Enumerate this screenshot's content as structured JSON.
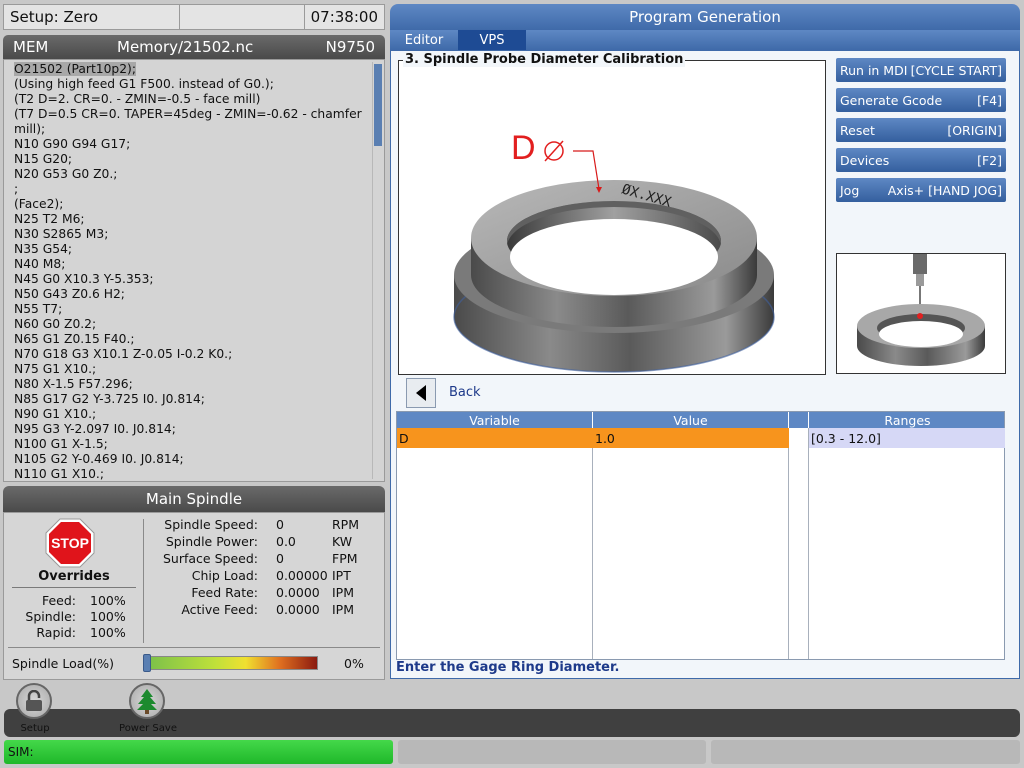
{
  "status": {
    "setup": "Setup: Zero",
    "clock": "07:38:00"
  },
  "program": {
    "mode": "MEM",
    "path": "Memory/21502.nc",
    "number": "N9750",
    "lines": [
      "O21502 (Part10p2);",
      "(Using high feed G1 F500. instead of G0.);",
      "(T2 D=2. CR=0. - ZMIN=-0.5 - face mill)",
      "(T7 D=0.5 CR=0. TAPER=45deg - ZMIN=-0.62 - chamfer",
      "mill);",
      "N10 G90 G94 G17;",
      "N15 G20;",
      "N20 G53 G0 Z0.;",
      ";",
      "(Face2);",
      "N25 T2 M6;",
      "N30 S2865 M3;",
      "N35 G54;",
      "N40 M8;",
      "N45 G0 X10.3 Y-5.353;",
      "N50 G43 Z0.6 H2;",
      "N55 T7;",
      "N60 G0 Z0.2;",
      "N65 G1 Z0.15 F40.;",
      "N70 G18 G3 X10.1 Z-0.05 I-0.2 K0.;",
      "N75 G1 X10.;",
      "N80 X-1.5 F57.296;",
      "N85 G17 G2 Y-3.725 I0. J0.814;",
      "N90 G1 X10.;",
      "N95 G3 Y-2.097 I0. J0.814;",
      "N100 G1 X-1.5;",
      "N105 G2 Y-0.469 I0. J0.814;",
      "N110 G1 X10.;"
    ]
  },
  "spindle": {
    "title": "Main Spindle",
    "stop_label": "STOP",
    "overrides_title": "Overrides",
    "overrides": [
      {
        "label": "Feed:",
        "value": "100%"
      },
      {
        "label": "Spindle:",
        "value": "100%"
      },
      {
        "label": "Rapid:",
        "value": "100%"
      }
    ],
    "stats": [
      {
        "label": "Spindle Speed:",
        "value": "0",
        "unit": "RPM"
      },
      {
        "label": "Spindle Power:",
        "value": "0.0",
        "unit": "KW"
      },
      {
        "label": "Surface Speed:",
        "value": "0",
        "unit": "FPM"
      },
      {
        "label": "Chip Load:",
        "value": "0.00000",
        "unit": "IPT"
      },
      {
        "label": "Feed Rate:",
        "value": "0.0000",
        "unit": "IPM"
      },
      {
        "label": "Active Feed:",
        "value": "0.0000",
        "unit": "IPM"
      }
    ],
    "load_label": "Spindle Load(%)",
    "load_value": "0%"
  },
  "program_generation": {
    "title": "Program Generation",
    "tabs": [
      "Editor",
      "VPS"
    ],
    "active_tab": "VPS",
    "section_title": "3. Spindle Probe Diameter Calibration",
    "diagram_label": "D",
    "ring_engraving": "ØX.XXX",
    "buttons": [
      {
        "label": "Run in MDI",
        "key": "[CYCLE START]"
      },
      {
        "label": "Generate Gcode",
        "key": "[F4]"
      },
      {
        "label": "Reset",
        "key": "[ORIGIN]"
      },
      {
        "label": "Devices",
        "key": "[F2]"
      },
      {
        "label": "Jog",
        "key": "Axis+ [HAND JOG]"
      }
    ],
    "back_label": "Back",
    "table": {
      "headers": [
        "Variable",
        "Value",
        "",
        "Ranges"
      ],
      "rows": [
        {
          "variable": "D",
          "value": "1.0",
          "range": "[0.3 - 12.0]"
        }
      ]
    },
    "prompt": "Enter the Gage Ring Diameter."
  },
  "bottom": {
    "icons": [
      {
        "label": "Setup",
        "icon": "lock-icon"
      },
      {
        "label": "Power Save",
        "icon": "tree-icon"
      }
    ],
    "sim_label": "SIM:"
  },
  "colors": {
    "accent": "#3f6aa9",
    "row_highlight": "#f7941d",
    "range_highlight": "#d6d8f6",
    "sim": "#22c02c"
  }
}
